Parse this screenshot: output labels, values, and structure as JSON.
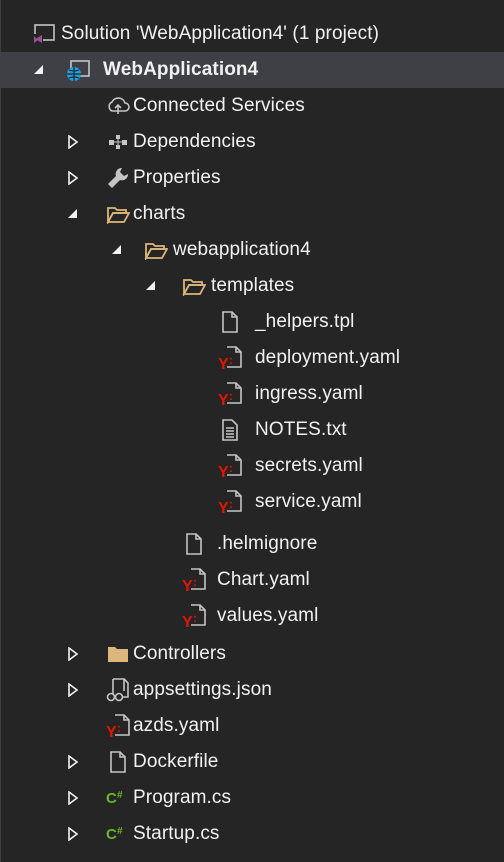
{
  "solution_explorer": {
    "solution_label": "Solution 'WebApplication4' (1 project)",
    "project_label": "WebApplication4",
    "items": {
      "connected_services": "Connected Services",
      "dependencies": "Dependencies",
      "properties": "Properties",
      "charts": "charts",
      "webapplication4": "webapplication4",
      "templates": "templates",
      "helpers_tpl": "_helpers.tpl",
      "deployment_yaml": "deployment.yaml",
      "ingress_yaml": "ingress.yaml",
      "notes_txt": "NOTES.txt",
      "secrets_yaml": "secrets.yaml",
      "service_yaml": "service.yaml",
      "helmignore": ".helmignore",
      "chart_yaml": "Chart.yaml",
      "values_yaml": "values.yaml",
      "controllers": "Controllers",
      "appsettings_json": "appsettings.json",
      "azds_yaml": "azds.yaml",
      "dockerfile": "Dockerfile",
      "program_cs": "Program.cs",
      "startup_cs": "Startup.cs"
    }
  },
  "colors": {
    "background": "#252526",
    "selected_row": "#3f3f46",
    "text": "#f1f1f1",
    "folder": "#dcb67a",
    "yaml_red": "#e51400",
    "csharp_green": "#68b723",
    "vs_purple": "#9b4f96",
    "globe_blue": "#1ba1e2"
  }
}
